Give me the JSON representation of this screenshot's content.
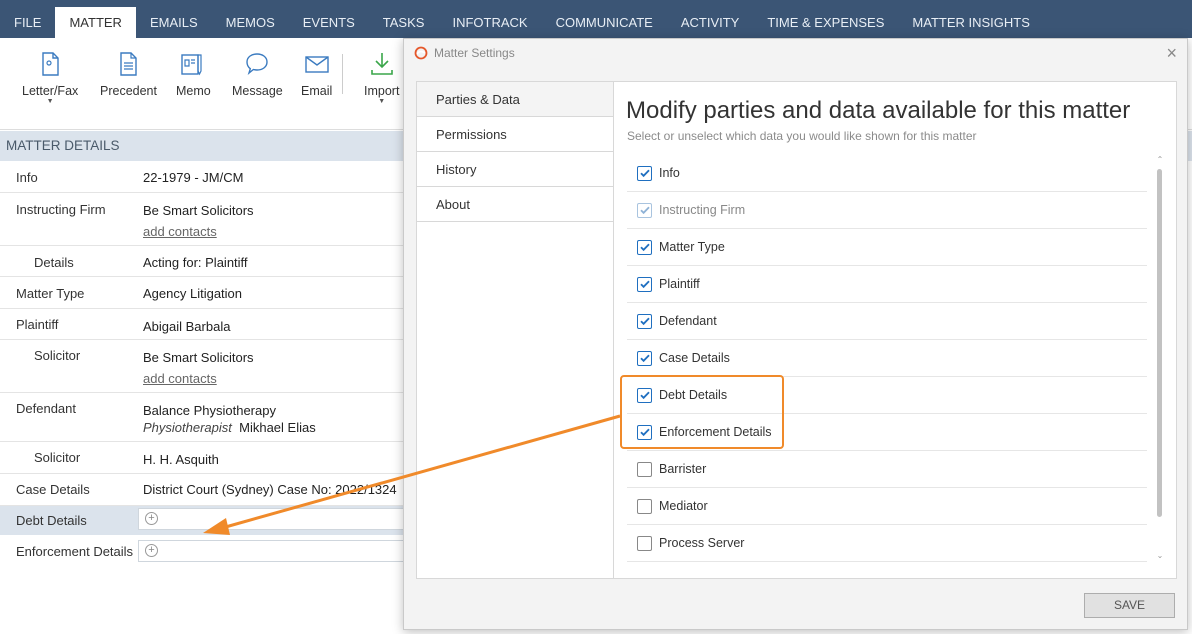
{
  "nav": {
    "tabs": [
      "FILE",
      "MATTER",
      "EMAILS",
      "MEMOS",
      "EVENTS",
      "TASKS",
      "INFOTRACK",
      "COMMUNICATE",
      "ACTIVITY",
      "TIME & EXPENSES",
      "MATTER INSIGHTS"
    ],
    "active": "MATTER"
  },
  "ribbon": {
    "letter_fax": "Letter/Fax",
    "precedent": "Precedent",
    "memo": "Memo",
    "message": "Message",
    "email": "Email",
    "import": "Import"
  },
  "matter_details": {
    "header": "MATTER DETAILS",
    "info_label": "Info",
    "info_value": "22-1979 - JM/CM",
    "instructing_label": "Instructing Firm",
    "instructing_value": "Be Smart Solicitors",
    "add_contacts": "add contacts",
    "details_label": "Details",
    "details_value": "Acting for: Plaintiff",
    "matter_type_label": "Matter Type",
    "matter_type_value": "Agency Litigation",
    "plaintiff_label": "Plaintiff",
    "plaintiff_value": "Abigail Barbala",
    "solicitor_label": "Solicitor",
    "plaintiff_solicitor_value": "Be Smart Solicitors",
    "defendant_label": "Defendant",
    "defendant_value": "Balance Physiotherapy",
    "defendant_role": "Physiotherapist",
    "defendant_person": "Mikhael Elias",
    "defendant_solicitor_value": "H. H. Asquith",
    "case_details_label": "Case Details",
    "case_details_value": "District Court (Sydney) Case No: 2022/1324",
    "debt_details_label": "Debt Details",
    "enforcement_details_label": "Enforcement Details"
  },
  "modal": {
    "title": "Matter Settings",
    "sidebar": [
      "Parties & Data",
      "Permissions",
      "History",
      "About"
    ],
    "heading": "Modify parties and data available for this matter",
    "subheading": "Select or unselect which data you would like shown for this matter",
    "items": [
      {
        "label": "Info",
        "checked": true,
        "disabled": false
      },
      {
        "label": "Instructing Firm",
        "checked": true,
        "disabled": true
      },
      {
        "label": "Matter Type",
        "checked": true,
        "disabled": false
      },
      {
        "label": "Plaintiff",
        "checked": true,
        "disabled": false
      },
      {
        "label": "Defendant",
        "checked": true,
        "disabled": false
      },
      {
        "label": "Case Details",
        "checked": true,
        "disabled": false
      },
      {
        "label": "Debt Details",
        "checked": true,
        "disabled": false
      },
      {
        "label": "Enforcement Details",
        "checked": true,
        "disabled": false
      },
      {
        "label": "Barrister",
        "checked": false,
        "disabled": false
      },
      {
        "label": "Mediator",
        "checked": false,
        "disabled": false
      },
      {
        "label": "Process Server",
        "checked": false,
        "disabled": false
      }
    ],
    "save": "SAVE"
  },
  "colors": {
    "nav_bg": "#3b5575",
    "highlight": "#f08a2a",
    "checkbox": "#1f6fc0",
    "header_bg": "#dbe3ec"
  }
}
